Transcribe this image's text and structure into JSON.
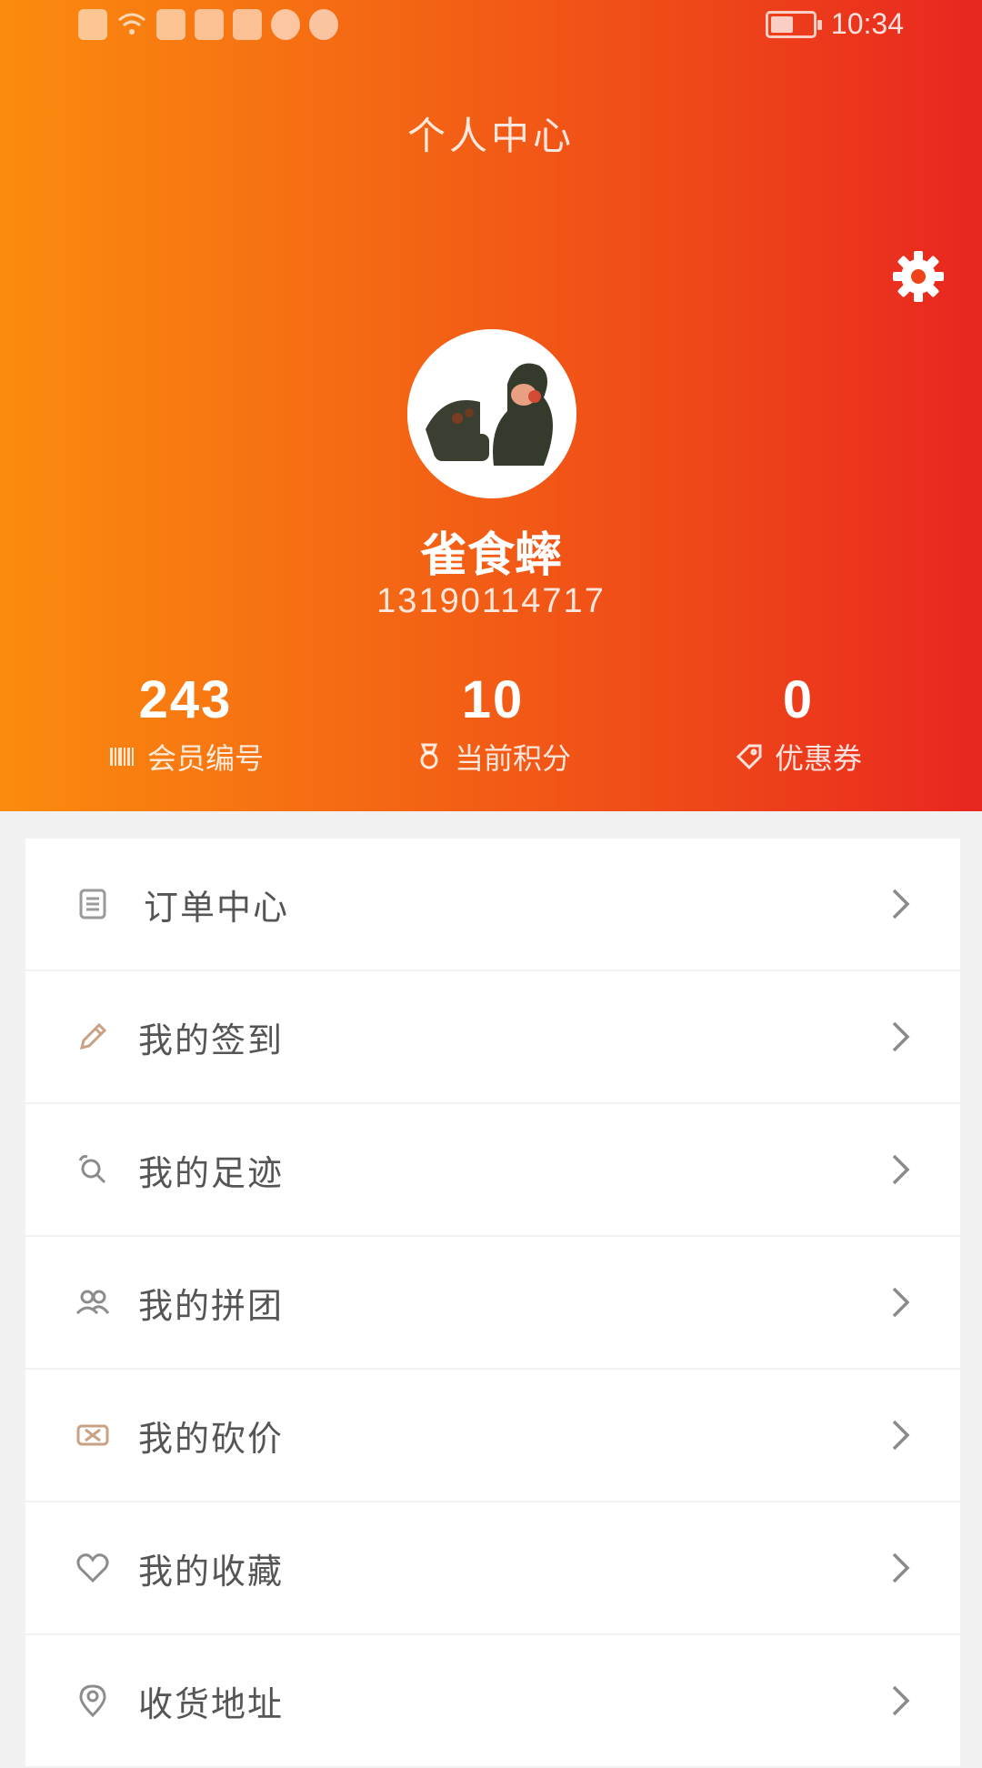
{
  "status_bar": {
    "time": "10:34",
    "left_icons": [
      "sim-icon",
      "wifi-icon",
      "shield-icon",
      "app-icon",
      "app-icon",
      "eye-icon",
      "eye-icon"
    ],
    "battery_level": 0.55
  },
  "header": {
    "title": "个人中心",
    "settings_icon": "gear-icon",
    "colors": {
      "gradient_start": "#fb8b0e",
      "gradient_end": "#e82620"
    }
  },
  "profile": {
    "nickname": "雀食蟀",
    "phone": "13190114717"
  },
  "stats": [
    {
      "value": "243",
      "label": "会员编号",
      "icon": "barcode-icon"
    },
    {
      "value": "10",
      "label": "当前积分",
      "icon": "medal-icon"
    },
    {
      "value": "0",
      "label": "优惠券",
      "icon": "tag-icon"
    }
  ],
  "menu": [
    {
      "label": "订单中心",
      "icon": "order-list-icon"
    },
    {
      "label": "我的签到",
      "icon": "pencil-icon"
    },
    {
      "label": "我的足迹",
      "icon": "footprint-icon"
    },
    {
      "label": "我的拼团",
      "icon": "group-icon"
    },
    {
      "label": "我的砍价",
      "icon": "bargain-icon"
    },
    {
      "label": "我的收藏",
      "icon": "heart-icon"
    },
    {
      "label": "收货地址",
      "icon": "location-pin-icon"
    }
  ]
}
